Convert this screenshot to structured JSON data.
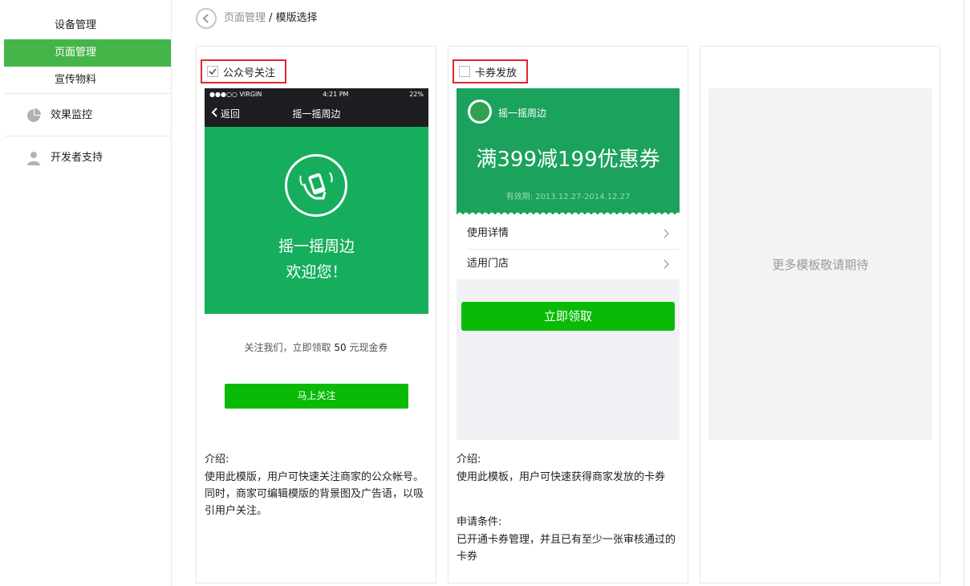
{
  "sidebar": {
    "sub_items": [
      {
        "label": "设备管理"
      },
      {
        "label": "页面管理"
      },
      {
        "label": "宣传物料"
      }
    ],
    "main_items": [
      {
        "label": "效果监控",
        "icon": "pie-chart-icon"
      },
      {
        "label": "开发者支持",
        "icon": "user-icon"
      }
    ]
  },
  "breadcrumb": {
    "parent": "页面管理",
    "separator": " / ",
    "current": "模版选择"
  },
  "templates": [
    {
      "title": "公众号关注",
      "checked": true,
      "preview": {
        "status_carrier": "●●●○○ VIRGIN",
        "status_time": "4:21 PM",
        "status_battery": "22%",
        "nav_back": "返回",
        "nav_title": "摇一摇周边",
        "hero_title": "摇一摇周边",
        "hero_sub": "欢迎您！"
      },
      "follow_text_prefix": "关注我们，立即领取 ",
      "follow_text_amount": "50",
      "follow_text_suffix": " 元现金券",
      "follow_button": "马上关注",
      "intro_title": "介绍:",
      "intro_text": "使用此模版，用户可快速关注商家的公众帐号。同时，商家可编辑模版的背景图及广告语，以吸引用户关注。"
    },
    {
      "title": "卡券发放",
      "checked": false,
      "preview": {
        "brand": "摇一摇周边",
        "coupon_title": "满399减199优惠券",
        "valid": "有效期: 2013.12.27-2014.12.27",
        "row1": "使用详情",
        "row2": "适用门店",
        "claim_button": "立即领取"
      },
      "intro_title": "介绍:",
      "intro_text": "使用此模板，用户可快速获得商家发放的卡券",
      "cond_title": "申请条件:",
      "cond_text": "已开通卡券管理，并且已有至少一张审核通过的卡券"
    }
  ],
  "more_placeholder": "更多模板敬请期待",
  "colors": {
    "accent_green": "#44b549",
    "button_green": "#09bb07",
    "hero_green": "#16ae5d",
    "highlight_red": "#e0282c"
  }
}
